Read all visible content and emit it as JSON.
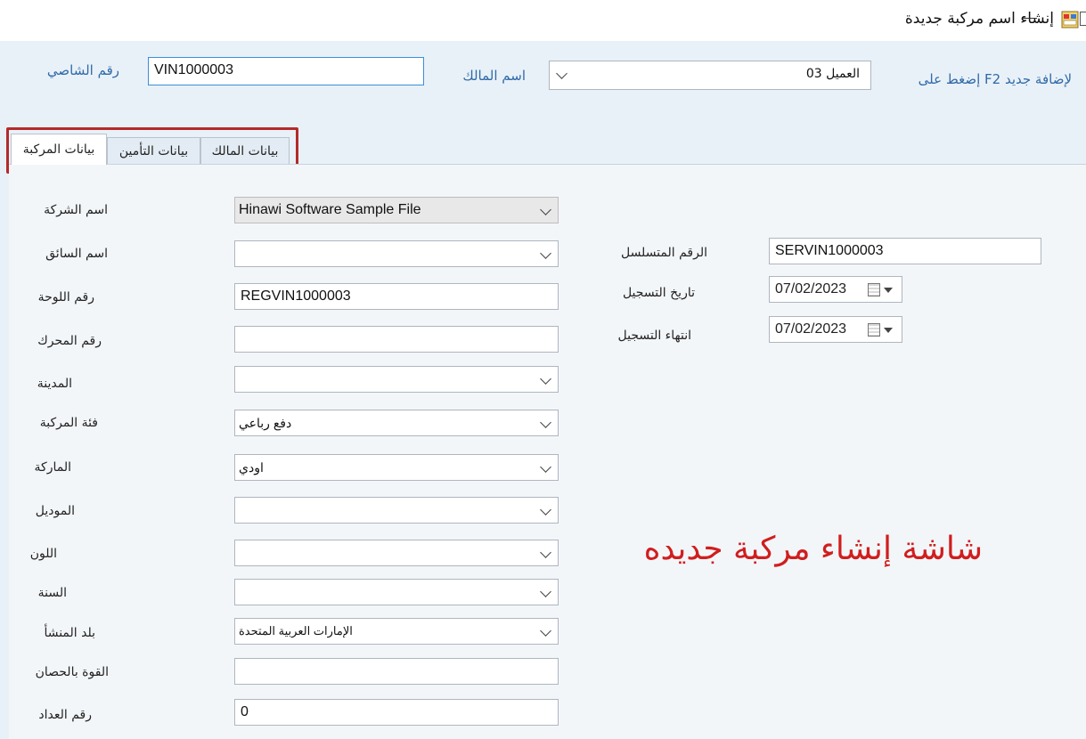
{
  "window": {
    "title": "إنشاء اسم مركبة جديدة"
  },
  "header": {
    "chassis_label": "رقم الشاصي",
    "chassis_value": "VIN1000003",
    "owner_label": "اسم المالك",
    "owner_value": "العميل 03",
    "add_new_hint": "لإضافة جديد F2 إضغط على"
  },
  "tabs": [
    {
      "label": "بيانات المركبة",
      "active": true
    },
    {
      "label": "بيانات التأمين",
      "active": false
    },
    {
      "label": "بيانات المالك",
      "active": false
    }
  ],
  "form": {
    "company": {
      "label": "اسم الشركة",
      "value": "Hinawi Software Sample File"
    },
    "driver": {
      "label": "اسم السائق",
      "value": ""
    },
    "plate": {
      "label": "رقم اللوحة",
      "value": "REGVIN1000003"
    },
    "engine": {
      "label": "رقم المحرك",
      "value": ""
    },
    "city": {
      "label": "المدينة",
      "value": ""
    },
    "category": {
      "label": "فئة المركبة",
      "value": "دفع رباعي"
    },
    "brand": {
      "label": "الماركة",
      "value": "اودي"
    },
    "model": {
      "label": "الموديل",
      "value": ""
    },
    "color": {
      "label": "اللون",
      "value": ""
    },
    "year": {
      "label": "السنة",
      "value": ""
    },
    "origin": {
      "label": "بلد المنشأ",
      "value": "الإمارات العربية المتحدة"
    },
    "horsepower": {
      "label": "القوة بالحصان",
      "value": ""
    },
    "odometer": {
      "label": "رقم العداد",
      "value": "0"
    }
  },
  "right_form": {
    "serial": {
      "label": "الرقم المتسلسل",
      "value": "SERVIN1000003"
    },
    "reg_date": {
      "label": "تاريخ التسجيل",
      "value": "07/02/2023"
    },
    "reg_expiry": {
      "label": "انتهاء التسجيل",
      "value": "07/02/2023"
    }
  },
  "caption": "شاشة إنشاء مركبة جديده",
  "colors": {
    "accent_blue": "#2f6aa8",
    "highlight_red": "#b42a2a",
    "caption_red": "#d01e1e"
  }
}
